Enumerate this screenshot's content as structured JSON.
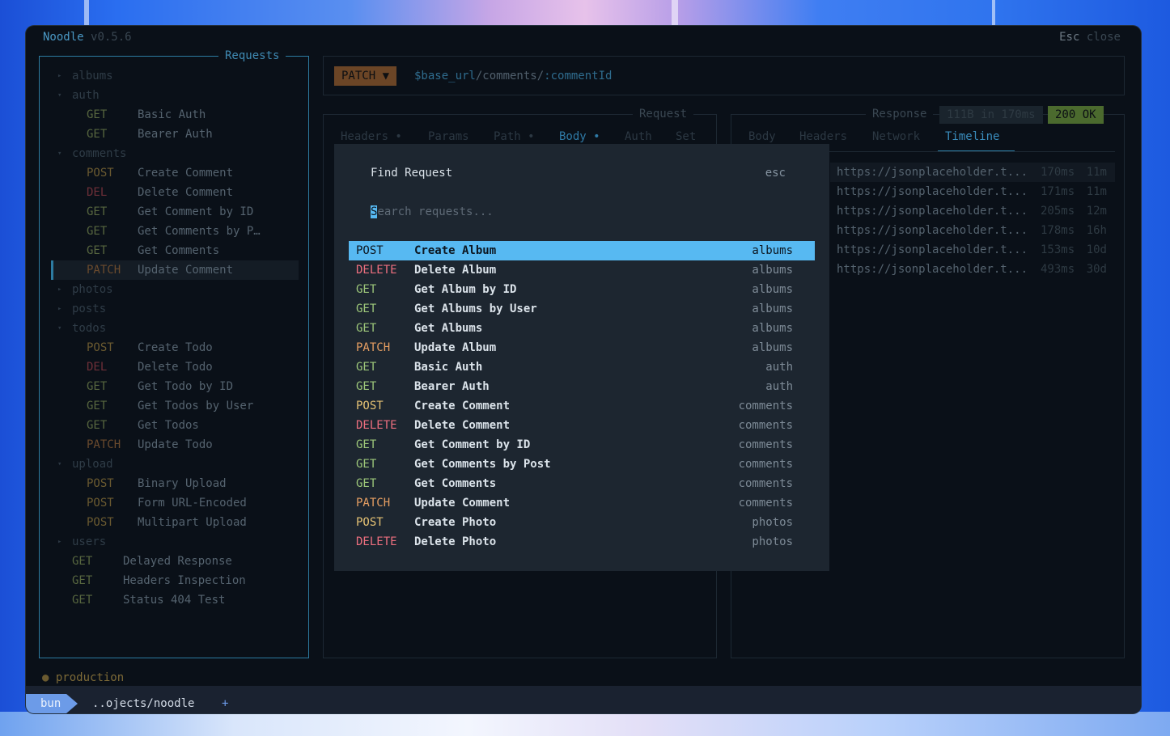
{
  "app": {
    "name": "Noodle",
    "version": "v0.5.6",
    "close_key": "Esc",
    "close_label": "close"
  },
  "sidebar": {
    "title": "Requests",
    "rows": [
      {
        "kind": "folder",
        "open": false,
        "label": "albums"
      },
      {
        "kind": "folder",
        "open": true,
        "label": "auth"
      },
      {
        "kind": "req",
        "method": "GET",
        "label": "Basic Auth",
        "indent": 1
      },
      {
        "kind": "req",
        "method": "GET",
        "label": "Bearer Auth",
        "indent": 1
      },
      {
        "kind": "folder",
        "open": true,
        "label": "comments"
      },
      {
        "kind": "req",
        "method": "POST",
        "label": "Create Comment",
        "indent": 1
      },
      {
        "kind": "req",
        "method": "DEL",
        "label": "Delete Comment",
        "indent": 1
      },
      {
        "kind": "req",
        "method": "GET",
        "label": "Get Comment by ID",
        "indent": 1
      },
      {
        "kind": "req",
        "method": "GET",
        "label": "Get Comments by P…",
        "indent": 1
      },
      {
        "kind": "req",
        "method": "GET",
        "label": "Get Comments",
        "indent": 1
      },
      {
        "kind": "req",
        "method": "PATCH",
        "label": "Update Comment",
        "indent": 1,
        "selected": true
      },
      {
        "kind": "folder",
        "open": false,
        "label": "photos"
      },
      {
        "kind": "folder",
        "open": false,
        "label": "posts"
      },
      {
        "kind": "folder",
        "open": true,
        "label": "todos"
      },
      {
        "kind": "req",
        "method": "POST",
        "label": "Create Todo",
        "indent": 1
      },
      {
        "kind": "req",
        "method": "DEL",
        "label": "Delete Todo",
        "indent": 1
      },
      {
        "kind": "req",
        "method": "GET",
        "label": "Get Todo by ID",
        "indent": 1
      },
      {
        "kind": "req",
        "method": "GET",
        "label": "Get Todos by User",
        "indent": 1
      },
      {
        "kind": "req",
        "method": "GET",
        "label": "Get Todos",
        "indent": 1
      },
      {
        "kind": "req",
        "method": "PATCH",
        "label": "Update Todo",
        "indent": 1
      },
      {
        "kind": "folder",
        "open": true,
        "label": "upload"
      },
      {
        "kind": "req",
        "method": "POST",
        "label": "Binary Upload",
        "indent": 1
      },
      {
        "kind": "req",
        "method": "POST",
        "label": "Form URL-Encoded",
        "indent": 1
      },
      {
        "kind": "req",
        "method": "POST",
        "label": "Multipart Upload",
        "indent": 1
      },
      {
        "kind": "folder",
        "open": false,
        "label": "users"
      },
      {
        "kind": "req",
        "method": "GET",
        "label": "Delayed Response",
        "indent": 0
      },
      {
        "kind": "req",
        "method": "GET",
        "label": "Headers Inspection",
        "indent": 0
      },
      {
        "kind": "req",
        "method": "GET",
        "label": "Status 404 Test",
        "indent": 0
      }
    ]
  },
  "urlbar": {
    "method": "PATCH ▼",
    "url_var": "$base_url",
    "url_path": "/comments/",
    "url_param": ":commentId"
  },
  "request_pane": {
    "title": "Request",
    "tabs": [
      {
        "label": "Headers •",
        "active": false
      },
      {
        "label": "Params",
        "active": false
      },
      {
        "label": "Path •",
        "active": false
      },
      {
        "label": "Body •",
        "active": true
      },
      {
        "label": "Auth",
        "active": false
      },
      {
        "label": "Set",
        "active": false
      }
    ]
  },
  "response_pane": {
    "title": "Response",
    "size_time": "111B in 170ms",
    "status": "200 OK",
    "tabs": [
      {
        "label": "Body",
        "active": false
      },
      {
        "label": "Headers",
        "active": false
      },
      {
        "label": "Network",
        "active": false
      },
      {
        "label": "Timeline",
        "active": true
      }
    ],
    "timeline": [
      {
        "url": "https://jsonplaceholder.t...",
        "time": "170ms",
        "age": "11m"
      },
      {
        "url": "https://jsonplaceholder.t...",
        "time": "171ms",
        "age": "11m"
      },
      {
        "url": "https://jsonplaceholder.t...",
        "time": "205ms",
        "age": "12m"
      },
      {
        "url": "https://jsonplaceholder.t...",
        "time": "178ms",
        "age": "16h"
      },
      {
        "url": "https://jsonplaceholder.t...",
        "time": "153ms",
        "age": "10d"
      },
      {
        "url": "https://jsonplaceholder.t...",
        "time": "493ms",
        "age": "30d"
      }
    ]
  },
  "modal": {
    "title": "Find Request",
    "esc_label": "esc",
    "search_cursor": "S",
    "search_placeholder": "earch requests...",
    "results": [
      {
        "method": "POST",
        "name": "Create Album",
        "group": "albums",
        "selected": true
      },
      {
        "method": "DELETE",
        "name": "Delete Album",
        "group": "albums"
      },
      {
        "method": "GET",
        "name": "Get Album by ID",
        "group": "albums"
      },
      {
        "method": "GET",
        "name": "Get Albums by User",
        "group": "albums"
      },
      {
        "method": "GET",
        "name": "Get Albums",
        "group": "albums"
      },
      {
        "method": "PATCH",
        "name": "Update Album",
        "group": "albums"
      },
      {
        "method": "GET",
        "name": "Basic Auth",
        "group": "auth"
      },
      {
        "method": "GET",
        "name": "Bearer Auth",
        "group": "auth"
      },
      {
        "method": "POST",
        "name": "Create Comment",
        "group": "comments"
      },
      {
        "method": "DELETE",
        "name": "Delete Comment",
        "group": "comments"
      },
      {
        "method": "GET",
        "name": "Get Comment by ID",
        "group": "comments"
      },
      {
        "method": "GET",
        "name": "Get Comments by Post",
        "group": "comments"
      },
      {
        "method": "GET",
        "name": "Get Comments",
        "group": "comments"
      },
      {
        "method": "PATCH",
        "name": "Update Comment",
        "group": "comments"
      },
      {
        "method": "POST",
        "name": "Create Photo",
        "group": "photos"
      },
      {
        "method": "DELETE",
        "name": "Delete Photo",
        "group": "photos"
      }
    ]
  },
  "environment": {
    "dot": "●",
    "name": "production"
  },
  "tmux": {
    "session": "bun",
    "path": "..ojects/noodle",
    "plus": "+"
  },
  "colors": {
    "accent": "#57b9f2",
    "get": "#9dc77a",
    "post": "#e5c274",
    "delete": "#ed6f7f",
    "patch": "#e59e62",
    "status_ok": "#4b6a2e"
  }
}
